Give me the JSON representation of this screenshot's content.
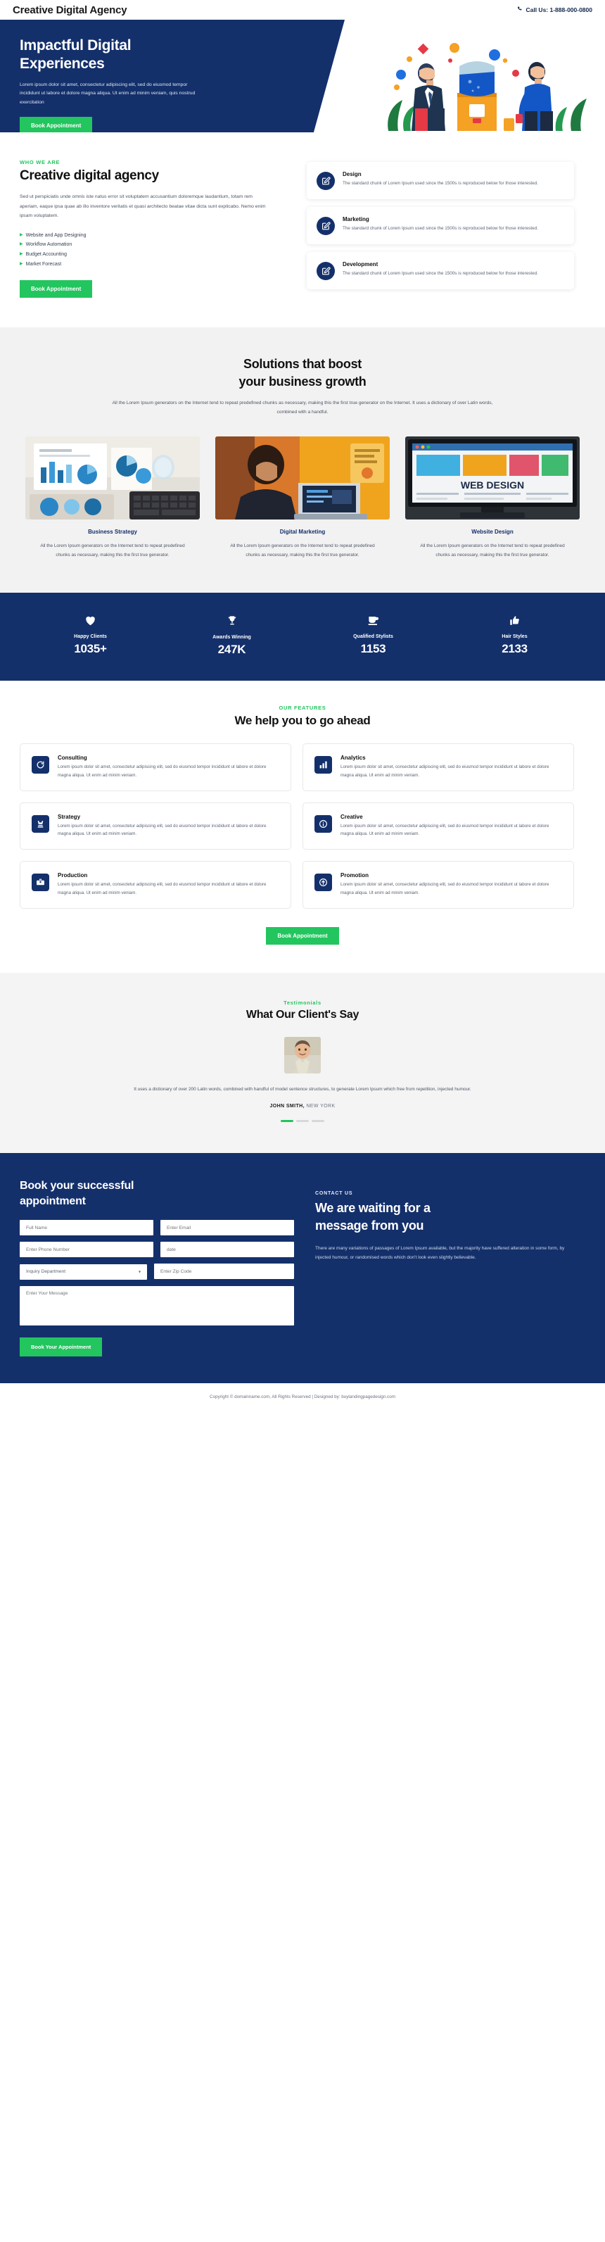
{
  "header": {
    "brand": "Creative Digital Agency",
    "phone_icon": "phone-icon",
    "call_us": "Call Us: 1-888-000-0800"
  },
  "hero": {
    "title_line1": "Impactful Digital",
    "title_line2": "Experiences",
    "paragraph": "Lorem ipsum dolor sit amet, consectetur adipiscing elit, sed do eiusmod tempor incididunt ut labore et dolore magna aliqua. Ut enim ad minim veniam, quis nostrud exercitation",
    "cta_label": "Book Appointment",
    "illustration": "office-workers-water-cooler-illustration"
  },
  "about": {
    "eyebrow": "WHO WE ARE",
    "title": "Creative digital agency",
    "paragraph": "Sed ut perspiciatis unde omnis iste natus error sit voluptatem accusantium doloremque laudantium, totam rem aperiam, eaque ipsa quae ab illo inventore veritatis et quasi architecto beatae vitae dicta sunt explicabo. Nemo enim ipsam voluptatem.",
    "bullets": [
      "Website and App Designing",
      "Workflow Automation",
      "Budget Accounting",
      "Market Forecast"
    ],
    "cta_label": "Book Appointment",
    "services": [
      {
        "icon": "pencil-edit-icon",
        "title": "Design",
        "text": "The standard chunk of Lorem Ipsum used since the 1500s is reproduced below for those interested."
      },
      {
        "icon": "pencil-edit-icon",
        "title": "Marketing",
        "text": "The standard chunk of Lorem Ipsum used since the 1500s is reproduced below for those interested."
      },
      {
        "icon": "pencil-edit-icon",
        "title": "Development",
        "text": "The standard chunk of Lorem Ipsum used since the 1500s is reproduced below for those interested."
      }
    ]
  },
  "solutions": {
    "title_line1": "Solutions that boost",
    "title_line2": "your business growth",
    "lead": "All the Lorem Ipsum generators on the Internet tend to repeat predefined chunks as necessary, making this the first true generator on the Internet. It uses a dictionary of over Latin words, combined with a handful.",
    "cards": [
      {
        "image": "desk-with-charts-laptop-photo",
        "title": "Business Strategy",
        "text": "All the Lorem Ipsum generators on the Internet tend to repeat predefined chunks as necessary, making this the first true generator."
      },
      {
        "image": "man-working-on-laptop-photo",
        "title": "Digital Marketing",
        "text": "All the Lorem Ipsum generators on the Internet tend to repeat predefined chunks as necessary, making this the first true generator."
      },
      {
        "image": "web-design-monitor-photo",
        "title": "Website Design",
        "text": "All the Lorem Ipsum generators on the Internet tend to repeat predefined chunks as necessary, making this the first true generator."
      }
    ]
  },
  "stats": [
    {
      "icon": "heart-icon",
      "glyph": "♥",
      "label": "Happy Clients",
      "value": "1035+"
    },
    {
      "icon": "trophy-icon",
      "glyph": "Ἴ6",
      "label": "Awards Winning",
      "value": "247K"
    },
    {
      "icon": "coffee-cup-icon",
      "glyph": "☕",
      "label": "Qualified Stylists",
      "value": "1153"
    },
    {
      "icon": "thumbs-up-icon",
      "glyph": "ὄD",
      "label": "Hair Styles",
      "value": "2133"
    }
  ],
  "features": {
    "eyebrow": "OUR FEATURES",
    "title": "We help you to go ahead",
    "cta_label": "Book Appointment",
    "items": [
      {
        "icon": "refresh-arrow-icon",
        "title": "Consulting",
        "text": "Lorem ipsum dolor sit amet, consectetur adipiscing elit, sed do eiusmod tempor incididunt ut labore et dolore magna aliqua. Ut enim ad minim veniam."
      },
      {
        "icon": "bar-chart-icon",
        "title": "Analytics",
        "text": "Lorem ipsum dolor sit amet, consectetur adipiscing elit, sed do eiusmod tempor incididunt ut labore et dolore magna aliqua. Ut enim ad minim veniam."
      },
      {
        "icon": "chess-king-icon",
        "title": "Strategy",
        "text": "Lorem ipsum dolor sit amet, consectetur adipiscing elit, sed do eiusmod tempor incididunt ut labore et dolore magna aliqua. Ut enim ad minim veniam."
      },
      {
        "icon": "lightbulb-info-icon",
        "title": "Creative",
        "text": "Lorem ipsum dolor sit amet, consectetur adipiscing elit, sed do eiusmod tempor incididunt ut labore et dolore magna aliqua. Ut enim ad minim veniam."
      },
      {
        "icon": "toolbox-icon",
        "title": "Production",
        "text": "Lorem ipsum dolor sit amet, consectetur adipiscing elit, sed do eiusmod tempor incididunt ut labore et dolore magna aliqua. Ut enim ad minim veniam."
      },
      {
        "icon": "megaphone-icon",
        "title": "Promotion",
        "text": "Lorem ipsum dolor sit amet, consectetur adipiscing elit, sed do eiusmod tempor incididunt ut labore et dolore magna aliqua. Ut enim ad minim veniam."
      }
    ]
  },
  "testimonials": {
    "eyebrow": "Testimonials",
    "title": "What Our Client's Say",
    "avatar": "smiling-man-portrait-photo",
    "quote": "It uses a dictionary of over 200 Latin words, combined with handful of model sentence structures, to generate Lorem Ipsum which free from repetition, injected humour.",
    "author_name": "JOHN SMITH,",
    "author_location": "NEW YORK",
    "dots_total": 3,
    "dots_active_index": 0
  },
  "booking": {
    "title_line1": "Book your successful",
    "title_line2": "appointment",
    "fields": {
      "full_name_placeholder": "Full Name",
      "email_placeholder": "Enter Email",
      "phone_placeholder": "Enter Phone Number",
      "date_placeholder": "date",
      "department_selected": "Inquiry Department",
      "zip_placeholder": "Enter Zip Code",
      "message_placeholder": "Enter Your Message"
    },
    "submit_label": "Book Your Appointment",
    "contact_eyebrow": "CONTACT US",
    "contact_title_line1": "We are waiting for a",
    "contact_title_line2": "message from you",
    "contact_paragraph": "There are many variations of passages of Lorem Ipsum available, but the majority have suffered alteration in some form, by injected humour, or randomised words which don't look even slightly believable."
  },
  "footer": {
    "text_before": "Copyright © domainname.com, All Rights Reserved | Designed by: ",
    "link": "buylandingpagedesign.com"
  },
  "colors": {
    "navy": "#14306b",
    "green": "#22c55e",
    "light_gray": "#f2f2f2",
    "text_dark": "#111111",
    "text_muted": "#4b5563"
  }
}
